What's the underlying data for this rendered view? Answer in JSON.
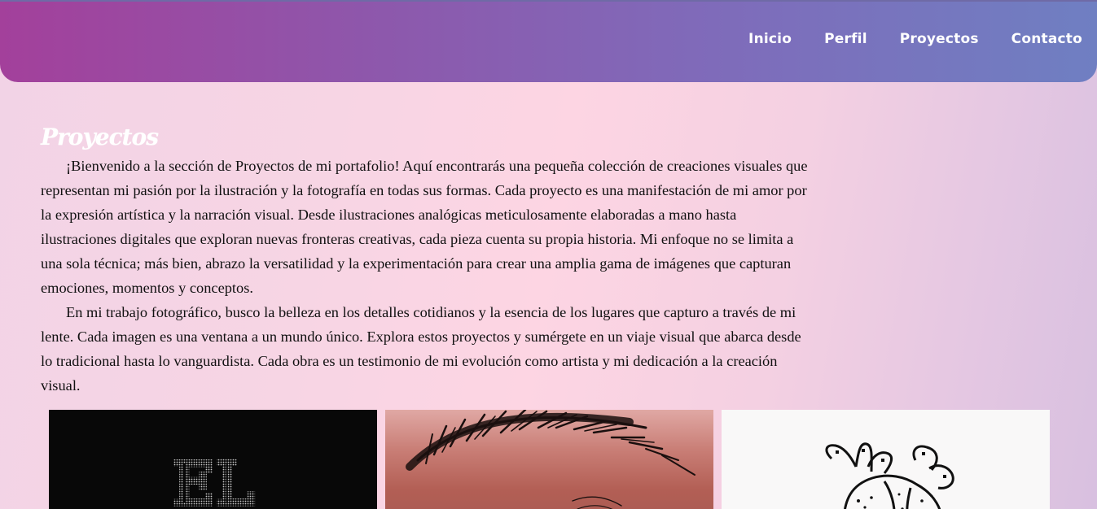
{
  "nav": {
    "items": [
      {
        "label": "Inicio"
      },
      {
        "label": "Perfil"
      },
      {
        "label": "Proyectos"
      },
      {
        "label": "Contacto"
      }
    ]
  },
  "main": {
    "title": "Proyectos",
    "paragraphs": [
      "¡Bienvenido a la sección de Proyectos de mi portafolio! Aquí encontrarás una pequeña colección de creaciones visuales que representan mi pasión por la ilustración y la fotografía en todas sus formas. Cada proyecto es una manifestación de mi amor por la expresión artística y la narración visual. Desde ilustraciones analógicas meticulosamente elaboradas a mano hasta ilustraciones digitales que exploran nuevas fronteras creativas, cada pieza cuenta su propia historia. Mi enfoque no se limita a una sola técnica; más bien, abrazo la versatilidad y la experimentación para crear una amplia gama de imágenes que capturan emociones, momentos y conceptos.",
      "En mi trabajo fotográfico, busco la belleza en los detalles cotidianos y la esencia de los lugares que capturo a través de mi lente. Cada imagen es una ventana a un mundo único. Explora estos proyectos y sumérgete en un viaje visual que abarca desde lo tradicional hasta lo vanguardista. Cada obra es un testimonio de mi evolución como artista y mi dedicación a la creación visual."
    ]
  },
  "gallery": {
    "tiles": [
      {
        "artwork_text": "EL"
      }
    ]
  }
}
